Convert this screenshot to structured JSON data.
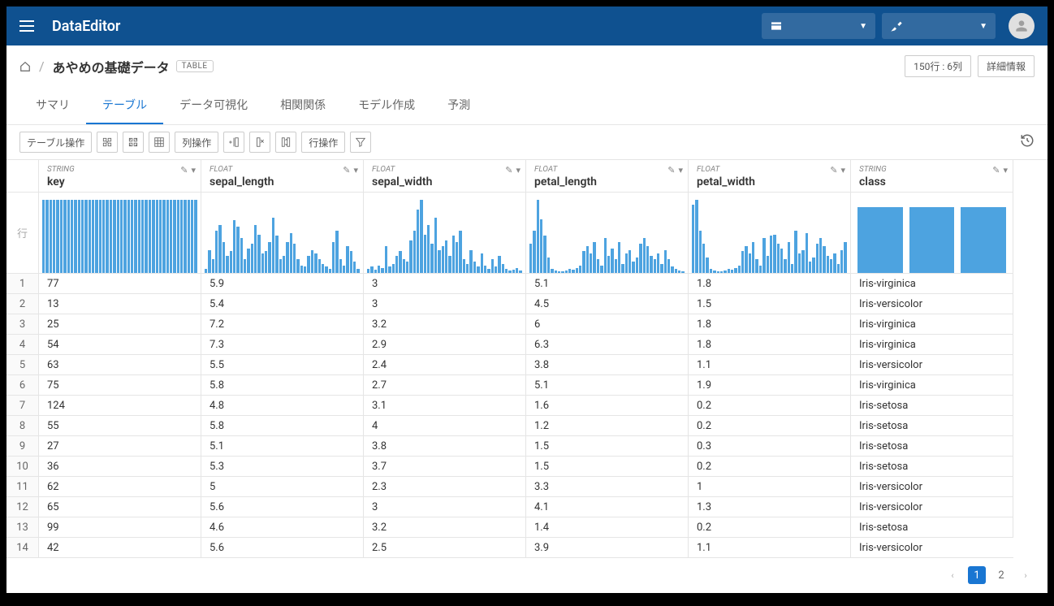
{
  "app": {
    "title": "DataEditor"
  },
  "breadcrumb": {
    "title": "あやめの基礎データ",
    "badge": "TABLE",
    "dims": "150行 : 6列",
    "details_btn": "詳細情報"
  },
  "tabs": [
    {
      "label": "サマリ",
      "active": false
    },
    {
      "label": "テーブル",
      "active": true
    },
    {
      "label": "データ可視化",
      "active": false
    },
    {
      "label": "相関関係",
      "active": false
    },
    {
      "label": "モデル作成",
      "active": false
    },
    {
      "label": "予測",
      "active": false
    }
  ],
  "toolbar": {
    "table_ops": "テーブル操作",
    "col_ops": "列操作",
    "row_ops": "行操作"
  },
  "row_label": "行",
  "columns": [
    {
      "type": "STRING",
      "name": "key"
    },
    {
      "type": "FLOAT",
      "name": "sepal_length"
    },
    {
      "type": "FLOAT",
      "name": "sepal_width"
    },
    {
      "type": "FLOAT",
      "name": "petal_length"
    },
    {
      "type": "FLOAT",
      "name": "petal_width"
    },
    {
      "type": "STRING",
      "name": "class"
    }
  ],
  "histograms": {
    "key": [
      95,
      95,
      95,
      95,
      95,
      95,
      95,
      95,
      95,
      95,
      95,
      95,
      95,
      95,
      95,
      95,
      95,
      95,
      95,
      95,
      95,
      95,
      95,
      95,
      95,
      95,
      95,
      95,
      95,
      95,
      95,
      95,
      95,
      95,
      95,
      95,
      95,
      95,
      95,
      95,
      95,
      95,
      95,
      95
    ],
    "sepal_length": [
      5,
      30,
      18,
      55,
      62,
      40,
      22,
      28,
      68,
      60,
      45,
      18,
      32,
      38,
      62,
      50,
      25,
      28,
      40,
      72,
      48,
      18,
      22,
      40,
      52,
      38,
      18,
      10,
      8,
      22,
      30,
      25,
      18,
      12,
      8,
      5,
      40,
      55,
      18,
      10,
      35,
      28,
      15,
      5
    ],
    "sepal_width": [
      5,
      8,
      4,
      10,
      6,
      35,
      8,
      12,
      22,
      28,
      18,
      15,
      42,
      55,
      82,
      95,
      50,
      62,
      38,
      72,
      30,
      35,
      42,
      22,
      48,
      40,
      55,
      18,
      12,
      30,
      15,
      8,
      25,
      10,
      5,
      18,
      8,
      22,
      12,
      5,
      3,
      4,
      6,
      3
    ],
    "petal_length": [
      38,
      55,
      95,
      70,
      48,
      20,
      5,
      3,
      2,
      2,
      3,
      5,
      4,
      6,
      10,
      28,
      35,
      25,
      40,
      18,
      10,
      45,
      22,
      32,
      18,
      40,
      12,
      25,
      30,
      15,
      20,
      38,
      45,
      35,
      22,
      18,
      25,
      12,
      30,
      18,
      8,
      5,
      3,
      2
    ],
    "petal_width": [
      88,
      95,
      55,
      38,
      20,
      5,
      3,
      2,
      2,
      3,
      5,
      4,
      6,
      10,
      28,
      35,
      25,
      40,
      18,
      10,
      45,
      22,
      48,
      50,
      38,
      32,
      18,
      40,
      12,
      55,
      25,
      30,
      52,
      15,
      20,
      38,
      45,
      35,
      22,
      18,
      25,
      12,
      30,
      40
    ],
    "class": [
      85,
      85,
      85
    ]
  },
  "rows": [
    {
      "n": "1",
      "key": "77",
      "sepal_length": "5.9",
      "sepal_width": "3",
      "petal_length": "5.1",
      "petal_width": "1.8",
      "class": "Iris-virginica"
    },
    {
      "n": "2",
      "key": "13",
      "sepal_length": "5.4",
      "sepal_width": "3",
      "petal_length": "4.5",
      "petal_width": "1.5",
      "class": "Iris-versicolor"
    },
    {
      "n": "3",
      "key": "25",
      "sepal_length": "7.2",
      "sepal_width": "3.2",
      "petal_length": "6",
      "petal_width": "1.8",
      "class": "Iris-virginica"
    },
    {
      "n": "4",
      "key": "54",
      "sepal_length": "7.3",
      "sepal_width": "2.9",
      "petal_length": "6.3",
      "petal_width": "1.8",
      "class": "Iris-virginica"
    },
    {
      "n": "5",
      "key": "63",
      "sepal_length": "5.5",
      "sepal_width": "2.4",
      "petal_length": "3.8",
      "petal_width": "1.1",
      "class": "Iris-versicolor"
    },
    {
      "n": "6",
      "key": "75",
      "sepal_length": "5.8",
      "sepal_width": "2.7",
      "petal_length": "5.1",
      "petal_width": "1.9",
      "class": "Iris-virginica"
    },
    {
      "n": "7",
      "key": "124",
      "sepal_length": "4.8",
      "sepal_width": "3.1",
      "petal_length": "1.6",
      "petal_width": "0.2",
      "class": "Iris-setosa"
    },
    {
      "n": "8",
      "key": "55",
      "sepal_length": "5.8",
      "sepal_width": "4",
      "petal_length": "1.2",
      "petal_width": "0.2",
      "class": "Iris-setosa"
    },
    {
      "n": "9",
      "key": "27",
      "sepal_length": "5.1",
      "sepal_width": "3.8",
      "petal_length": "1.5",
      "petal_width": "0.3",
      "class": "Iris-setosa"
    },
    {
      "n": "10",
      "key": "36",
      "sepal_length": "5.3",
      "sepal_width": "3.7",
      "petal_length": "1.5",
      "petal_width": "0.2",
      "class": "Iris-setosa"
    },
    {
      "n": "11",
      "key": "62",
      "sepal_length": "5",
      "sepal_width": "2.3",
      "petal_length": "3.3",
      "petal_width": "1",
      "class": "Iris-versicolor"
    },
    {
      "n": "12",
      "key": "65",
      "sepal_length": "5.6",
      "sepal_width": "3",
      "petal_length": "4.1",
      "petal_width": "1.3",
      "class": "Iris-versicolor"
    },
    {
      "n": "13",
      "key": "99",
      "sepal_length": "4.6",
      "sepal_width": "3.2",
      "petal_length": "1.4",
      "petal_width": "0.2",
      "class": "Iris-setosa"
    },
    {
      "n": "14",
      "key": "42",
      "sepal_length": "5.6",
      "sepal_width": "2.5",
      "petal_length": "3.9",
      "petal_width": "1.1",
      "class": "Iris-versicolor"
    }
  ],
  "pagination": {
    "pages": [
      "1",
      "2"
    ],
    "active": "1"
  },
  "chart_data": {
    "type": "table",
    "title": "あやめの基礎データ",
    "columns": [
      "key",
      "sepal_length",
      "sepal_width",
      "petal_length",
      "petal_width",
      "class"
    ],
    "rows": [
      [
        "77",
        5.9,
        3,
        5.1,
        1.8,
        "Iris-virginica"
      ],
      [
        "13",
        5.4,
        3,
        4.5,
        1.5,
        "Iris-versicolor"
      ],
      [
        "25",
        7.2,
        3.2,
        6,
        1.8,
        "Iris-virginica"
      ],
      [
        "54",
        7.3,
        2.9,
        6.3,
        1.8,
        "Iris-virginica"
      ],
      [
        "63",
        5.5,
        2.4,
        3.8,
        1.1,
        "Iris-versicolor"
      ],
      [
        "75",
        5.8,
        2.7,
        5.1,
        1.9,
        "Iris-virginica"
      ],
      [
        "124",
        4.8,
        3.1,
        1.6,
        0.2,
        "Iris-setosa"
      ],
      [
        "55",
        5.8,
        4,
        1.2,
        0.2,
        "Iris-setosa"
      ],
      [
        "27",
        5.1,
        3.8,
        1.5,
        0.3,
        "Iris-setosa"
      ],
      [
        "36",
        5.3,
        3.7,
        1.5,
        0.2,
        "Iris-setosa"
      ],
      [
        "62",
        5,
        2.3,
        3.3,
        1,
        "Iris-versicolor"
      ],
      [
        "65",
        5.6,
        3,
        4.1,
        1.3,
        "Iris-versicolor"
      ],
      [
        "99",
        4.6,
        3.2,
        1.4,
        0.2,
        "Iris-setosa"
      ],
      [
        "42",
        5.6,
        2.5,
        3.9,
        1.1,
        "Iris-versicolor"
      ]
    ]
  }
}
